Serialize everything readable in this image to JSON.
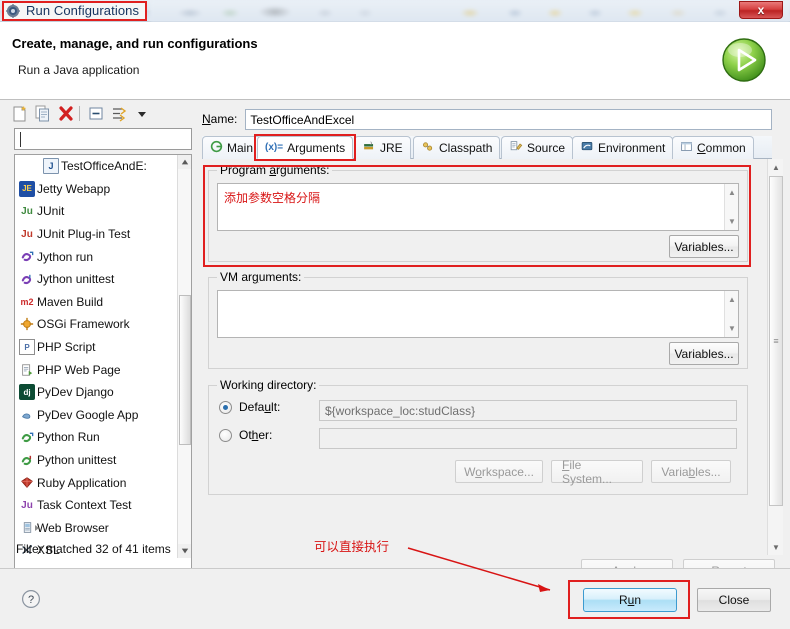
{
  "window": {
    "title": "Run Configurations",
    "title_icon": "run-config-gear-icon",
    "close_label": "x"
  },
  "header": {
    "title": "Create, manage, and run configurations",
    "subtitle": "Run a Java application",
    "run_icon": "green-play-run-icon"
  },
  "sidebar": {
    "toolbar": [
      {
        "name": "new-launch-configuration-icon",
        "label": ""
      },
      {
        "name": "duplicate-icon",
        "label": ""
      },
      {
        "name": "delete-icon",
        "label": ""
      },
      {
        "name": "collapse-all-icon",
        "label": ""
      },
      {
        "name": "filter-icon",
        "label": ""
      },
      {
        "name": "view-menu-chevron-down-icon",
        "label": ""
      }
    ],
    "filter": {
      "value": "",
      "placeholder": ""
    },
    "items": [
      {
        "label": "TestOfficeAndE:",
        "icon": "java-application-icon",
        "icon_text": "J",
        "selected": true,
        "expandable": false
      },
      {
        "label": "Jetty Webapp",
        "icon": "jetty-icon",
        "icon_text": "JE",
        "selected": false,
        "expandable": false
      },
      {
        "label": "JUnit",
        "icon": "junit-icon",
        "icon_text": "Ju",
        "selected": false,
        "expandable": false
      },
      {
        "label": "JUnit Plug-in Test",
        "icon": "junit-plugin-icon",
        "icon_text": "Ju",
        "selected": false,
        "expandable": false
      },
      {
        "label": "Jython run",
        "icon": "jython-run-icon",
        "icon_text": "J",
        "selected": false,
        "expandable": false
      },
      {
        "label": "Jython unittest",
        "icon": "jython-unittest-icon",
        "icon_text": "U",
        "selected": false,
        "expandable": false
      },
      {
        "label": "Maven Build",
        "icon": "maven-icon",
        "icon_text": "m2",
        "selected": false,
        "expandable": false
      },
      {
        "label": "OSGi Framework",
        "icon": "osgi-icon",
        "icon_text": "",
        "selected": false,
        "expandable": false
      },
      {
        "label": "PHP Script",
        "icon": "php-script-icon",
        "icon_text": "P",
        "selected": false,
        "expandable": false
      },
      {
        "label": "PHP Web Page",
        "icon": "php-web-page-icon",
        "icon_text": "",
        "selected": false,
        "expandable": false
      },
      {
        "label": "PyDev Django",
        "icon": "pydev-django-icon",
        "icon_text": "dj",
        "selected": false,
        "expandable": false
      },
      {
        "label": "PyDev Google App",
        "icon": "pydev-google-app-icon",
        "icon_text": "",
        "selected": false,
        "expandable": false
      },
      {
        "label": "Python Run",
        "icon": "python-run-icon",
        "icon_text": "P",
        "selected": false,
        "expandable": false
      },
      {
        "label": "Python unittest",
        "icon": "python-unittest-icon",
        "icon_text": "U",
        "selected": false,
        "expandable": false
      },
      {
        "label": "Ruby Application",
        "icon": "ruby-icon",
        "icon_text": "",
        "selected": false,
        "expandable": false
      },
      {
        "label": "Task Context Test",
        "icon": "task-context-icon",
        "icon_text": "Ju",
        "selected": false,
        "expandable": false
      },
      {
        "label": "Web Browser",
        "icon": "web-browser-icon",
        "icon_text": "",
        "selected": false,
        "expandable": true
      },
      {
        "label": "XSL",
        "icon": "xsl-icon",
        "icon_text": "",
        "selected": false,
        "expandable": false
      }
    ],
    "status": "Filter matched 32 of 41 items",
    "hscroll_grip": "|||"
  },
  "main": {
    "name_label_pre": "N",
    "name_label_post": "ame:",
    "name_value": "TestOfficeAndExcel",
    "tabs": [
      {
        "label": "Main",
        "icon": "main-tab-icon",
        "icon_text": "G",
        "active": false,
        "mnemonic": ""
      },
      {
        "label": "Arguments",
        "icon": "arguments-tab-icon",
        "icon_text": "(x)=",
        "active": true,
        "mnemonic": ""
      },
      {
        "label": "JRE",
        "icon": "jre-tab-icon",
        "icon_text": "",
        "active": false,
        "mnemonic": ""
      },
      {
        "label": "Classpath",
        "icon": "classpath-tab-icon",
        "icon_text": "",
        "active": false,
        "mnemonic": ""
      },
      {
        "label": "Source",
        "icon": "source-tab-icon",
        "icon_text": "",
        "active": false,
        "mnemonic": ""
      },
      {
        "label": "Environment",
        "icon": "environment-tab-icon",
        "icon_text": "",
        "active": false,
        "mnemonic": ""
      },
      {
        "label": "Common",
        "icon": "common-tab-icon",
        "icon_text": "",
        "active": false,
        "mnemonic": "C"
      }
    ],
    "program_arguments": {
      "label_pre": "Program ",
      "label_mn": "a",
      "label_post": "rguments:",
      "value": "添加参数空格分隔",
      "variables_button": "Variables..."
    },
    "vm_arguments": {
      "label_pre": "VM ar",
      "label_mn": "g",
      "label_post": "uments:",
      "value": "",
      "variables_button": "Variables..."
    },
    "working_directory": {
      "label": "Working directory:",
      "default_pre": "Defa",
      "default_mn": "u",
      "default_post": "lt:",
      "default_checked": true,
      "default_value": "${workspace_loc:studClass}",
      "other_pre": "Ot",
      "other_mn": "h",
      "other_post": "er:",
      "other_checked": false,
      "other_value": "",
      "buttons": [
        {
          "pre": "W",
          "mn": "o",
          "post": "rkspace...",
          "label": "Workspace...",
          "disabled": true
        },
        {
          "pre": "",
          "mn": "F",
          "post": "ile System...",
          "label": "File System...",
          "disabled": true
        },
        {
          "pre": "Varia",
          "mn": "b",
          "post": "les...",
          "label": "Variables...",
          "disabled": true
        }
      ]
    },
    "apply_button": {
      "pre": "Appl",
      "mn": "y",
      "post": "",
      "label": "Apply",
      "disabled": true
    },
    "revert_button": {
      "pre": "Re",
      "mn": "v",
      "post": "ert",
      "label": "Revert",
      "disabled": true
    }
  },
  "footer": {
    "help_icon": "help-question-icon",
    "run_button": {
      "pre": "R",
      "mn": "u",
      "post": "n",
      "label": "Run"
    },
    "close_button": {
      "label": "Close"
    }
  },
  "annotations": {
    "color": "#d81414",
    "box_color": "#e01f1f",
    "program_args_note": "添加参数空格分隔",
    "run_note": "可以直接执行"
  }
}
